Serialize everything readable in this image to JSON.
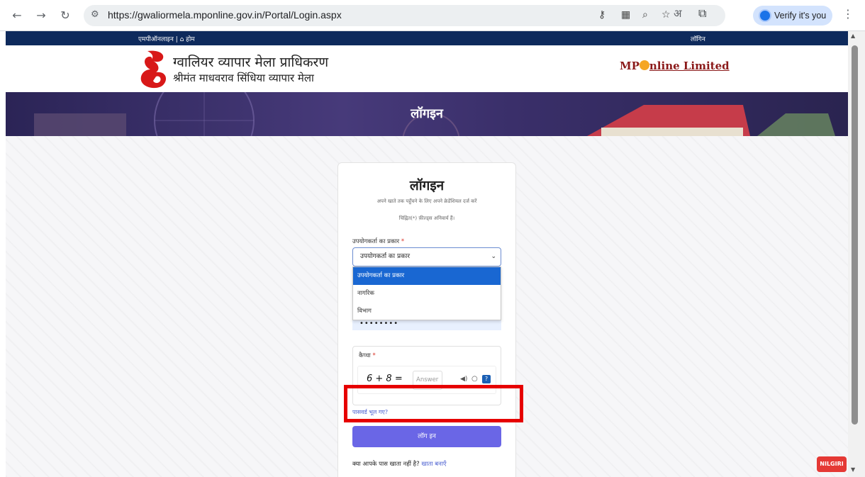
{
  "browser": {
    "url": "https://gwaliormela.mponline.gov.in/Portal/Login.aspx",
    "translate_glyph": "अ",
    "verify_label": "Verify it's you"
  },
  "topbar": {
    "left": "एमपीऑनलाइन | ⌂ होम",
    "right": "लॉगिन"
  },
  "header": {
    "title_line1": "ग्वालियर व्यापार मेला प्राधिकरण",
    "title_line2": "श्रीमंत माधवराव सिंधिया व्यापार मेला",
    "partner_mp": "MP",
    "partner_rest": "nline Limited"
  },
  "banner": {
    "title": "लॉगइन"
  },
  "card": {
    "title": "लॉगइन",
    "subtitle": "अपने खाते तक पहुँचने के लिए अपने क्रेडेंशियल दर्ज करें",
    "required_note": "चिह्नित(*) फ़ील्ड्स अनिवार्य हैं।",
    "usertype_label": "उपयोगकर्ता का प्रकार",
    "required_mark": "*",
    "usertype_selected": "उपयोगकर्ता का प्रकार",
    "dropdown_options": [
      "उपयोगकर्ता का प्रकार",
      "नागरिक",
      "विभाग"
    ],
    "password_mask": "••••••••",
    "captcha_label": "कैप्चा",
    "captcha_equation": "6 + 8 =",
    "captcha_placeholder": "Answer",
    "help_glyph": "?",
    "forgot_link": "पासवर्ड भूल गए?",
    "login_button": "लॉग इन",
    "signup_prompt": "क्या आपके पास खाता नहीं है?",
    "signup_link": "खाता बनाएँ"
  },
  "badge": {
    "label": "NILGIRI"
  },
  "colors": {
    "primary_button": "#6a66e6",
    "topbar": "#0e2a5c",
    "highlight": "#e60000"
  }
}
